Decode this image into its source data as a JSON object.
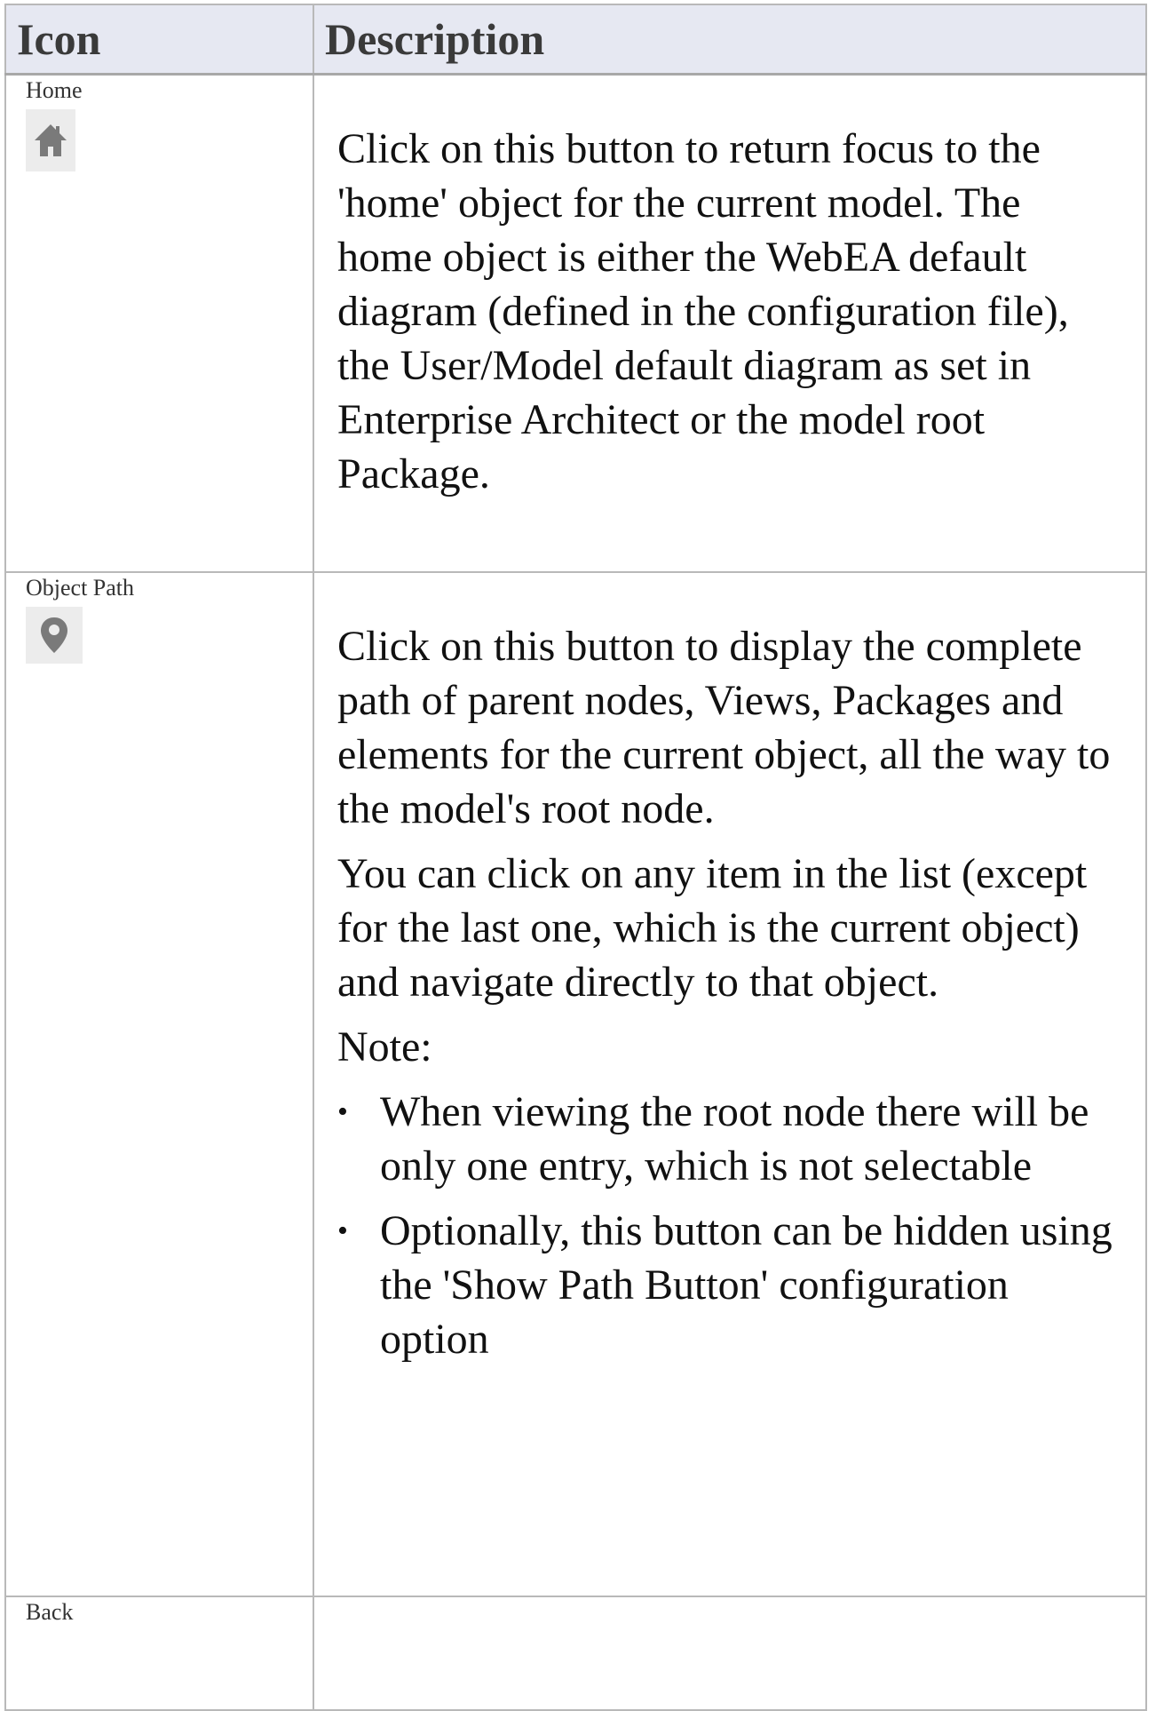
{
  "table": {
    "header": {
      "icon_col": "Icon",
      "description_col": "Description"
    },
    "rows": [
      {
        "label": "Home",
        "icon": "home-icon",
        "paragraphs": [
          "Click on this button to return focus to the 'home' object for the current model. The home object is either the WebEA default diagram (defined in the configuration file), the User/Model default diagram as set in Enterprise Architect or the model root Package."
        ]
      },
      {
        "label": "Object Path",
        "icon": "map-pin-icon",
        "paragraphs": [
          "Click on this button to display the complete path of parent nodes, Views, Packages and elements for the current object, all the way to the model's root node.",
          "You can click on any item in the list (except for the last one, which is the current object) and navigate directly to that object.",
          "Note:"
        ],
        "bullets": [
          "When viewing the root node there will be only one entry, which is not selectable",
          "Optionally, this button can be hidden using the 'Show Path Button' configuration option"
        ]
      },
      {
        "label": "Back"
      }
    ]
  },
  "colors": {
    "header_bg": "#e6e8f2",
    "border": "#b9b9b9",
    "icon_bg": "#ececec",
    "icon_fg": "#7a7a7a"
  }
}
